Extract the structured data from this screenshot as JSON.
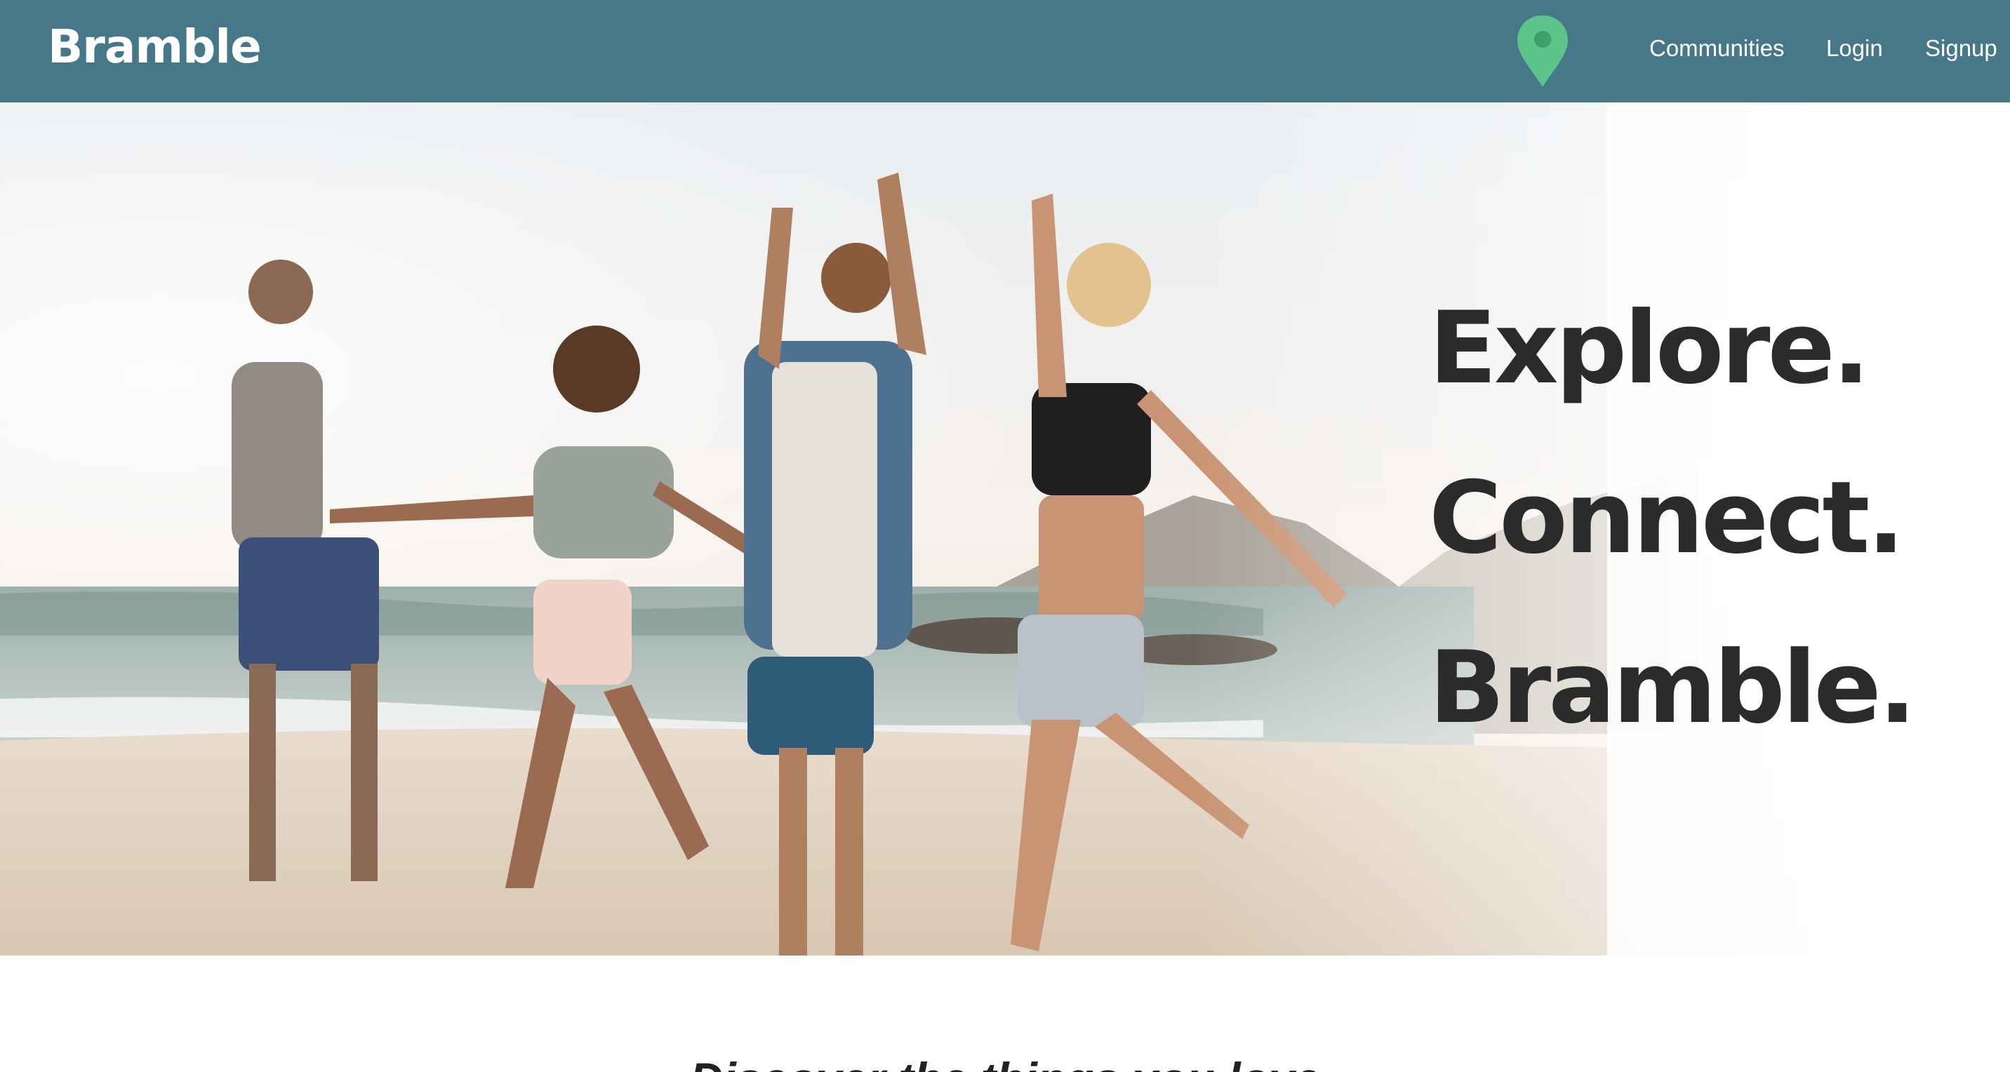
{
  "header": {
    "brand": "Bramble",
    "location_icon": "map-pin-icon",
    "nav": [
      "Communities",
      "Login",
      "Signup"
    ]
  },
  "hero": {
    "image_alt": "Friends dancing on the beach",
    "tagline": [
      "Explore.",
      "Connect.",
      "Bramble."
    ]
  },
  "intro": {
    "subheading": "Discover the things you love"
  },
  "colors": {
    "navbar": "#47788a",
    "pin": "#5cc489",
    "tagline": "#2b2b2b"
  }
}
